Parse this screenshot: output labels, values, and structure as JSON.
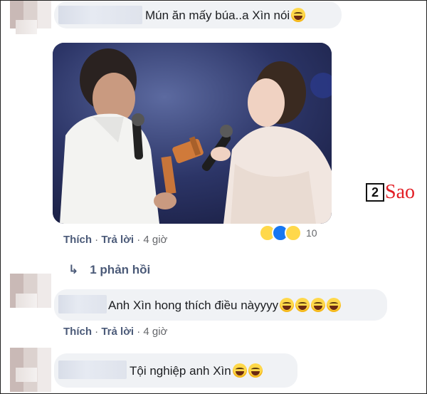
{
  "comments": [
    {
      "text": "Mún ăn mấy búa..a Xìn nói",
      "actions": {
        "like": "Thích",
        "reply": "Trả lời",
        "time": "4 giờ"
      },
      "reaction_count": "10"
    },
    {
      "text": "Anh Xìn hong thích điều nàyyyy",
      "actions": {
        "like": "Thích",
        "reply": "Trả lời",
        "time": "4 giờ"
      }
    },
    {
      "text": "Tội nghiệp anh Xìn"
    }
  ],
  "replies_link": "1 phản hồi",
  "watermark": {
    "box": "2",
    "text": "Sao"
  },
  "colors": {
    "bubble": "#f0f2f5",
    "link": "#4b5a78",
    "watermark_red": "#e21d24"
  }
}
